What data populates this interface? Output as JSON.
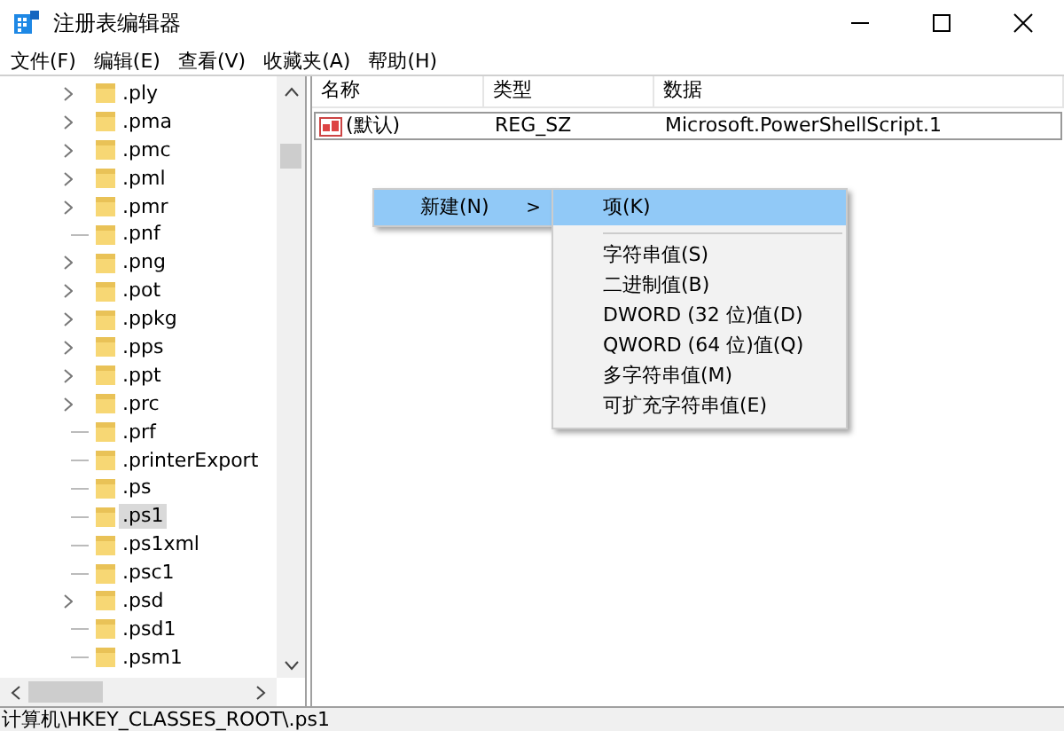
{
  "window": {
    "title": "注册表编辑器"
  },
  "menu_bar": [
    "文件(F)",
    "编辑(E)",
    "查看(V)",
    "收藏夹(A)",
    "帮助(H)"
  ],
  "tree": {
    "items": [
      {
        "label": ".ply",
        "expandable": true,
        "selected": false
      },
      {
        "label": ".pma",
        "expandable": true,
        "selected": false
      },
      {
        "label": ".pmc",
        "expandable": true,
        "selected": false
      },
      {
        "label": ".pml",
        "expandable": true,
        "selected": false
      },
      {
        "label": ".pmr",
        "expandable": true,
        "selected": false
      },
      {
        "label": ".pnf",
        "expandable": false,
        "selected": false
      },
      {
        "label": ".png",
        "expandable": true,
        "selected": false
      },
      {
        "label": ".pot",
        "expandable": true,
        "selected": false
      },
      {
        "label": ".ppkg",
        "expandable": true,
        "selected": false
      },
      {
        "label": ".pps",
        "expandable": true,
        "selected": false
      },
      {
        "label": ".ppt",
        "expandable": true,
        "selected": false
      },
      {
        "label": ".prc",
        "expandable": true,
        "selected": false
      },
      {
        "label": ".prf",
        "expandable": false,
        "selected": false
      },
      {
        "label": ".printerExport",
        "expandable": false,
        "selected": false
      },
      {
        "label": ".ps",
        "expandable": false,
        "selected": false
      },
      {
        "label": ".ps1",
        "expandable": false,
        "selected": true
      },
      {
        "label": ".ps1xml",
        "expandable": false,
        "selected": false
      },
      {
        "label": ".psc1",
        "expandable": false,
        "selected": false
      },
      {
        "label": ".psd",
        "expandable": true,
        "selected": false
      },
      {
        "label": ".psd1",
        "expandable": false,
        "selected": false
      },
      {
        "label": ".psm1",
        "expandable": false,
        "selected": false
      }
    ]
  },
  "table": {
    "columns": [
      "名称",
      "类型",
      "数据"
    ],
    "rows": [
      {
        "name": "(默认)",
        "type": "REG_SZ",
        "data": "Microsoft.PowerShellScript.1"
      }
    ]
  },
  "context_menu": {
    "items": [
      {
        "label": "新建(N)",
        "arrow": ">",
        "selected": true
      }
    ]
  },
  "submenu": {
    "items": [
      {
        "kind": "item",
        "label": "项(K)",
        "selected": true
      },
      {
        "kind": "separator"
      },
      {
        "kind": "item",
        "label": "字符串值(S)",
        "selected": false
      },
      {
        "kind": "item",
        "label": "二进制值(B)",
        "selected": false
      },
      {
        "kind": "item",
        "label": "DWORD (32 位)值(D)",
        "selected": false
      },
      {
        "kind": "item",
        "label": "QWORD (64 位)值(Q)",
        "selected": false
      },
      {
        "kind": "item",
        "label": "多字符串值(M)",
        "selected": false
      },
      {
        "kind": "item",
        "label": "可扩充字符串值(E)",
        "selected": false
      }
    ]
  },
  "status_bar": "计算机\\HKEY_CLASSES_ROOT\\.ps1"
}
